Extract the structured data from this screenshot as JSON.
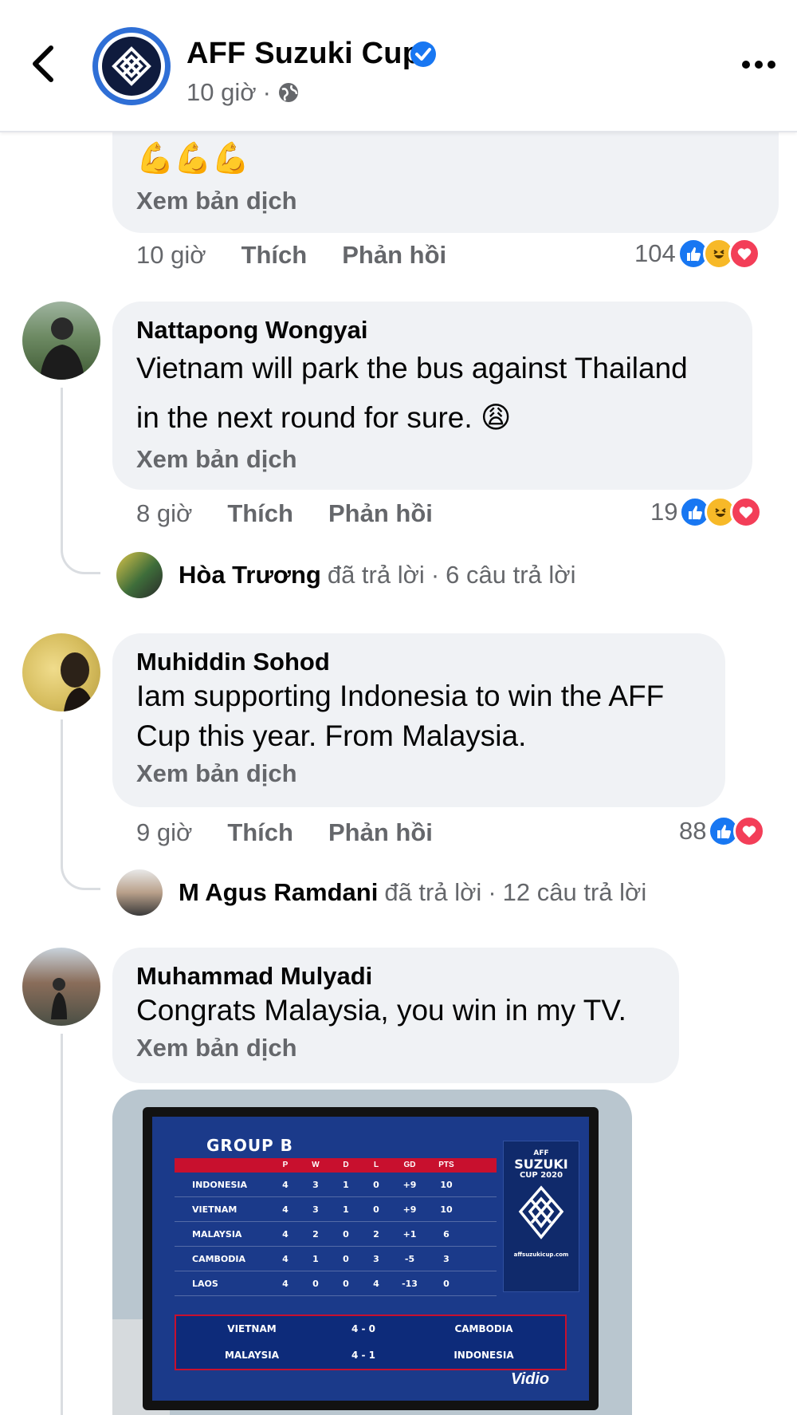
{
  "header": {
    "page_name": "AFF Suzuki Cup",
    "time": "10 giờ",
    "separator": "·"
  },
  "colors": {
    "like_blue": "#1877f2",
    "haha_yellow": "#f7b928",
    "love_red": "#f33e58",
    "bubble_bg": "#f0f2f5",
    "secondary_text": "#65676b"
  },
  "partial_comment": {
    "emoji": "💪💪💪",
    "translate": "Xem bản dịch",
    "time": "10 giờ",
    "like": "Thích",
    "reply": "Phản hồi",
    "reaction_count": "104",
    "reactions": [
      "like-icon",
      "haha-icon",
      "love-icon"
    ]
  },
  "comments": [
    {
      "author": "Nattapong Wongyai",
      "text_line1": "Vietnam will park the bus against Thailand",
      "text_line2": "in the next round for sure. 😩",
      "translate": "Xem bản dịch",
      "time": "8 giờ",
      "like": "Thích",
      "reply": "Phản hồi",
      "reaction_count": "19",
      "reactions": [
        "like-icon",
        "haha-icon",
        "love-icon"
      ],
      "replies": {
        "name": "Hòa Trương",
        "action": "đã trả lời",
        "count": "6 câu trả lời"
      }
    },
    {
      "author": "Muhiddin Sohod",
      "text_line1": "Iam supporting Indonesia to win the AFF",
      "text_line2": "Cup this year. From Malaysia.",
      "translate": "Xem bản dịch",
      "time": "9 giờ",
      "like": "Thích",
      "reply": "Phản hồi",
      "reaction_count": "88",
      "reactions": [
        "like-icon",
        "love-icon"
      ],
      "replies": {
        "name": "M Agus Ramdani",
        "action": "đã trả lời",
        "count": "12 câu trả lời"
      }
    },
    {
      "author": "Muhammad Mulyadi",
      "text_line1": "Congrats Malaysia, you win in my TV.",
      "translate": "Xem bản dịch"
    }
  ],
  "tv_image": {
    "title": "GROUP B",
    "columns": [
      "",
      "P",
      "W",
      "D",
      "L",
      "GD",
      "PTS"
    ],
    "rows": [
      [
        "INDONESIA",
        "4",
        "3",
        "1",
        "0",
        "+9",
        "10"
      ],
      [
        "VIETNAM",
        "4",
        "3",
        "1",
        "0",
        "+9",
        "10"
      ],
      [
        "MALAYSIA",
        "4",
        "2",
        "0",
        "2",
        "+1",
        "6"
      ],
      [
        "CAMBODIA",
        "4",
        "1",
        "0",
        "3",
        "-5",
        "3"
      ],
      [
        "LAOS",
        "4",
        "0",
        "0",
        "4",
        "-13",
        "0"
      ]
    ],
    "results": [
      [
        "VIETNAM",
        "4 - 0",
        "CAMBODIA"
      ],
      [
        "MALAYSIA",
        "4 - 1",
        "INDONESIA"
      ]
    ],
    "logo_l1": "AFF",
    "logo_l2": "SUZUKI",
    "logo_l3": "CUP 2020",
    "logo_url": "affsuzukicup.com",
    "broadcaster": "Vidio"
  }
}
